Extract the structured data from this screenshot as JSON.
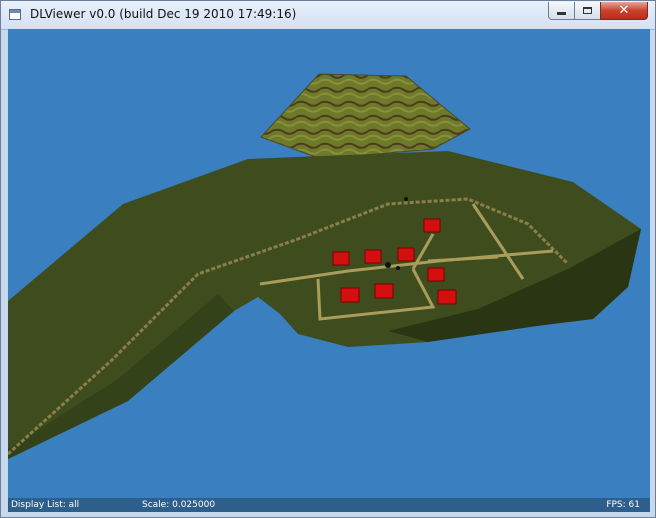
{
  "window": {
    "title": "DLViewer v0.0 (build Dec 19 2010 17:49:16)"
  },
  "title_buttons": [
    "minimize",
    "maximize",
    "close"
  ],
  "scene": {
    "sky_color": "#3a7fc0",
    "terrain_color": "#3f4d1e",
    "house_color": "#d40f0f",
    "road_color": "#a89d5a"
  },
  "status": {
    "display_list": "Display List: all",
    "scale": "Scale: 0.025000",
    "fps": "FPS: 61"
  }
}
